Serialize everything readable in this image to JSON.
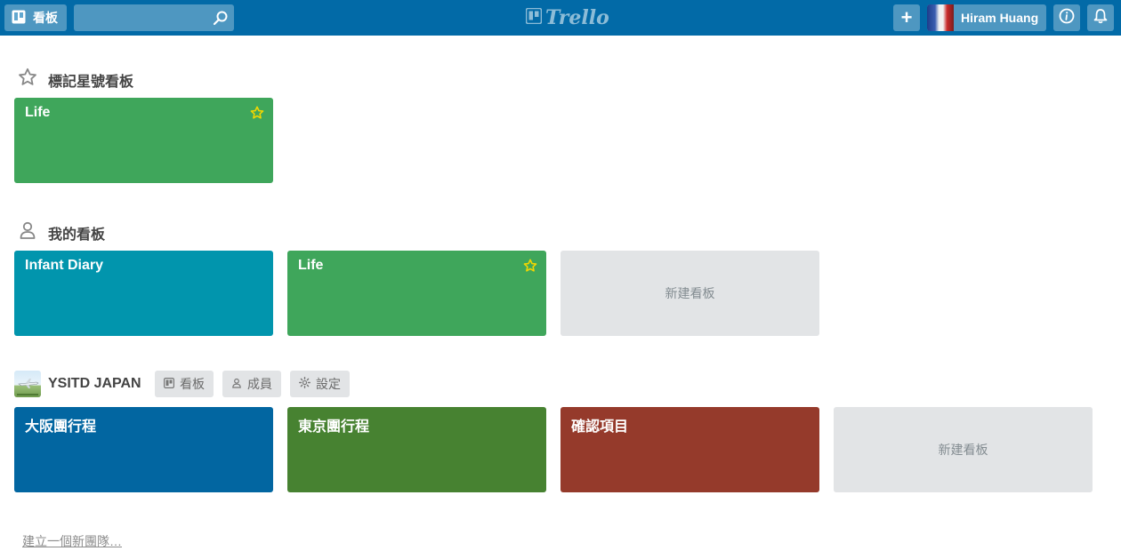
{
  "header": {
    "boards_label": "看板",
    "search_value": "",
    "logo_text": "Trello",
    "add_label": "+",
    "user_name": "Hiram Huang"
  },
  "starred": {
    "title": "標記星號看板",
    "boards": [
      {
        "name": "Life",
        "color": "#3fa65b",
        "starred": true
      }
    ]
  },
  "my_boards": {
    "title": "我的看板",
    "boards": [
      {
        "name": "Infant Diary",
        "color": "#0195ad",
        "starred": false
      },
      {
        "name": "Life",
        "color": "#3fa65b",
        "starred": true
      }
    ],
    "new_board_label": "新建看板"
  },
  "team": {
    "name": "YSITD JAPAN",
    "buttons": [
      {
        "label": "看板",
        "icon": "board-icon"
      },
      {
        "label": "成員",
        "icon": "member-icon"
      },
      {
        "label": "設定",
        "icon": "gear-icon"
      }
    ],
    "boards": [
      {
        "name": "大阪團行程",
        "color": "#0266a1"
      },
      {
        "name": "東京團行程",
        "color": "#478231"
      },
      {
        "name": "確認項目",
        "color": "#953a2b"
      }
    ],
    "new_board_label": "新建看板"
  },
  "create_team_label": "建立一個新團隊…",
  "colors": {
    "header": "#026aa7",
    "star": "#f2d600"
  }
}
